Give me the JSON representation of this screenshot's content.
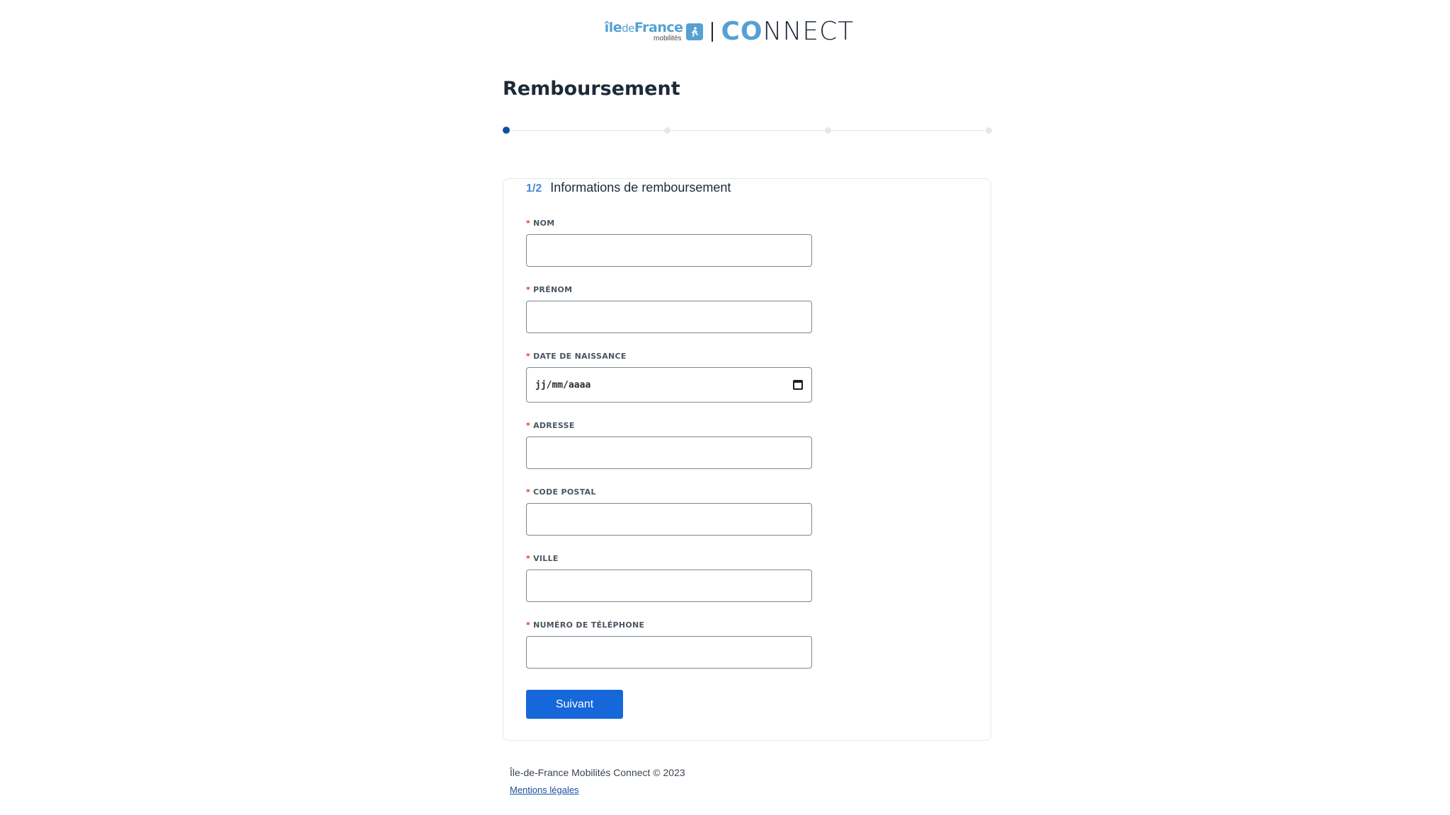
{
  "logo": {
    "brand_top_part1": "île",
    "brand_top_part2": "de",
    "brand_top_part3": "France",
    "brand_bottom": "mobilités",
    "product_co": "CO",
    "product_rest": "NNECT"
  },
  "page": {
    "title": "Remboursement"
  },
  "stepper": {
    "total_steps": 4,
    "current_step": 1
  },
  "form": {
    "step_indicator": "1/2",
    "section_title": "Informations de remboursement",
    "required_marker": "*",
    "fields": [
      {
        "label": "NOM",
        "value": ""
      },
      {
        "label": "PRÉNOM",
        "value": ""
      },
      {
        "label": "DATE DE NAISSANCE",
        "placeholder": "jj/mm/aaaa"
      },
      {
        "label": "ADRESSE",
        "value": ""
      },
      {
        "label": "CODE POSTAL",
        "value": ""
      },
      {
        "label": "VILLE",
        "value": ""
      },
      {
        "label": "NUMÉRO DE TÉLÉPHONE",
        "value": ""
      }
    ],
    "submit_label": "Suivant"
  },
  "footer": {
    "copyright": "Île-de-France Mobilités Connect © 2023",
    "legal_link": "Mentions légales"
  },
  "colors": {
    "primary": "#1667d9",
    "accent": "#56a0d3",
    "stepper_active": "#0f4ea3",
    "required": "#e3342f"
  },
  "icons": {
    "logo_badge": "person-walking-icon",
    "date_picker": "calendar-icon"
  }
}
